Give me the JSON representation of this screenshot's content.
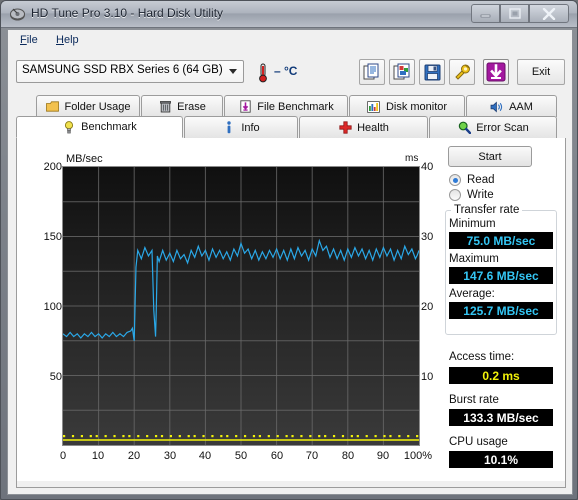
{
  "window": {
    "title": "HD Tune Pro 3.10 - Hard Disk Utility",
    "app_icon": "hard-disk-icon",
    "minimize": "—",
    "maximize": "❐",
    "close": "X"
  },
  "menu": {
    "items": [
      {
        "label": "File",
        "mnemonic": "F",
        "rest": "ile"
      },
      {
        "label": "Help",
        "mnemonic": "H",
        "rest": "elp"
      }
    ]
  },
  "toolbar": {
    "drive_selected": "SAMSUNG SSD RBX Series 6 (64 GB)",
    "drive_options": [
      "SAMSUNG SSD RBX Series 6 (64 GB)"
    ],
    "temperature": "– °C",
    "temperature_icon": "thermometer-icon",
    "buttons": [
      {
        "name": "copy-text-icon",
        "tooltip": "Copy text"
      },
      {
        "name": "copy-image-icon",
        "tooltip": "Copy screenshot"
      },
      {
        "name": "save-icon",
        "tooltip": "Save"
      },
      {
        "name": "options-icon",
        "tooltip": "Options"
      },
      {
        "name": "download-icon",
        "tooltip": "Download"
      }
    ],
    "exit_label": "Exit"
  },
  "tabs": {
    "top_row": [
      {
        "label": "Folder Usage",
        "icon": "folder-icon",
        "active": false
      },
      {
        "label": "Erase",
        "icon": "trash-icon",
        "active": false
      },
      {
        "label": "File Benchmark",
        "icon": "file-benchmark-icon",
        "active": false
      },
      {
        "label": "Disk monitor",
        "icon": "bar-chart-icon",
        "active": false
      },
      {
        "label": "AAM",
        "icon": "speaker-icon",
        "active": false
      }
    ],
    "bottom_row": [
      {
        "label": "Benchmark",
        "icon": "bulb-icon",
        "active": true
      },
      {
        "label": "Info",
        "icon": "info-icon",
        "active": false
      },
      {
        "label": "Health",
        "icon": "health-cross-icon",
        "active": false
      },
      {
        "label": "Error Scan",
        "icon": "magnifier-icon",
        "active": false
      }
    ]
  },
  "controls": {
    "start_label": "Start",
    "mode_selected": "Read",
    "modes": [
      {
        "label": "Read",
        "selected": true
      },
      {
        "label": "Write",
        "selected": false
      }
    ]
  },
  "results": {
    "transfer_rate_legend": "Transfer rate",
    "minimum_label": "Minimum",
    "minimum_value": "75.0 MB/sec",
    "maximum_label": "Maximum",
    "maximum_value": "147.6 MB/sec",
    "average_label": "Average:",
    "average_value": "125.7 MB/sec",
    "access_time_label": "Access time:",
    "access_time_value": "0.2 ms",
    "burst_rate_label": "Burst rate",
    "burst_rate_value": "133.3 MB/sec",
    "cpu_usage_label": "CPU usage",
    "cpu_usage_value": "10.1%"
  },
  "colors": {
    "transfer_curve": "#2aa8e8",
    "access_points": "#f2f20a",
    "plot_background": "#1b1b1b",
    "grid": "#6a6a6a",
    "value_cyan": "#34c6f4",
    "value_yellow": "#f2f20a",
    "value_white": "#ffffff"
  },
  "chart_data": {
    "type": "line",
    "title": "",
    "xlabel": "",
    "ylabel": "MB/sec",
    "y2label": "ms",
    "xlim": [
      0,
      100
    ],
    "ylim": [
      0,
      200
    ],
    "y2lim": [
      0,
      40
    ],
    "grid": true,
    "legend_position": "none",
    "xticks": [
      0,
      10,
      20,
      30,
      40,
      50,
      60,
      70,
      80,
      90,
      100
    ],
    "xtick_labels": [
      "0",
      "10",
      "20",
      "30",
      "40",
      "50",
      "60",
      "70",
      "80",
      "90",
      "100%"
    ],
    "yticks": [
      50,
      100,
      150,
      200
    ],
    "ytick_labels": [
      "50",
      "100",
      "150",
      "200"
    ],
    "y2ticks": [
      10,
      20,
      30,
      40
    ],
    "y2tick_labels": [
      "10",
      "20",
      "30",
      "40"
    ],
    "series": [
      {
        "name": "Transfer rate",
        "unit": "MB/sec",
        "axis": "left",
        "color": "#2aa8e8",
        "x": [
          0,
          1,
          2,
          3,
          4,
          5,
          6,
          7,
          8,
          9,
          10,
          11,
          12,
          13,
          14,
          15,
          16,
          17,
          18,
          19,
          19.5,
          20,
          20.5,
          21,
          22,
          23,
          24,
          25,
          25.5,
          26,
          26.2,
          26.5,
          27,
          28,
          29,
          30,
          31,
          32,
          33,
          34,
          35,
          36,
          37,
          38,
          39,
          40,
          41,
          42,
          43,
          44,
          45,
          46,
          47,
          48,
          49,
          50,
          51,
          52,
          53,
          54,
          55,
          56,
          57,
          58,
          59,
          60,
          61,
          62,
          63,
          64,
          65,
          66,
          67,
          68,
          69,
          70,
          71,
          72,
          73,
          74,
          75,
          76,
          77,
          78,
          79,
          80,
          81,
          82,
          83,
          84,
          85,
          86,
          87,
          88,
          89,
          90,
          91,
          92,
          93,
          94,
          95,
          96,
          97,
          98,
          99,
          100
        ],
        "y": [
          80,
          78,
          81,
          78,
          80,
          77,
          80,
          78,
          81,
          78,
          80,
          77,
          80,
          78,
          81,
          78,
          80,
          78,
          81,
          82,
          84,
          75,
          128,
          140,
          134,
          142,
          136,
          140,
          97,
          78,
          97,
          136,
          132,
          140,
          133,
          138,
          132,
          140,
          134,
          137,
          131,
          140,
          135,
          143,
          136,
          140,
          133,
          141,
          135,
          140,
          134,
          139,
          133,
          141,
          136,
          145,
          138,
          141,
          134,
          140,
          133,
          139,
          134,
          140,
          135,
          141,
          134,
          140,
          133,
          141,
          134,
          142,
          136,
          140,
          133,
          141,
          136,
          147,
          140,
          143,
          135,
          141,
          134,
          140,
          133,
          141,
          135,
          142,
          136,
          141,
          134,
          140,
          133,
          141,
          135,
          142,
          136,
          141,
          133,
          140,
          134,
          143,
          137,
          141,
          134,
          139,
          140
        ]
      },
      {
        "name": "Access time",
        "unit": "ms",
        "axis": "right",
        "color": "#f2f20a",
        "description": "near-zero access time trace drawn along the bottom of the plot",
        "x": [
          0,
          10,
          20,
          30,
          40,
          50,
          60,
          70,
          80,
          90,
          100
        ],
        "y": [
          0.2,
          0.2,
          0.2,
          0.2,
          0.2,
          0.2,
          0.2,
          0.2,
          0.2,
          0.2,
          0.2
        ]
      }
    ],
    "summary": {
      "minimum_mb_s": 75.0,
      "maximum_mb_s": 147.6,
      "average_mb_s": 125.7,
      "access_time_ms": 0.2,
      "burst_rate_mb_s": 133.3,
      "cpu_usage_percent": 10.1
    }
  }
}
